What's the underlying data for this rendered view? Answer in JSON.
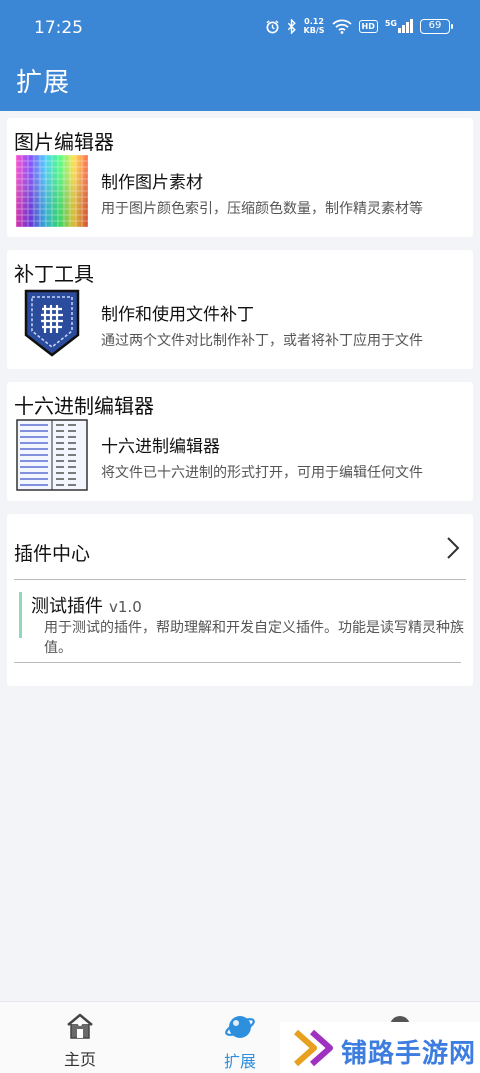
{
  "status_bar": {
    "time": "17:25",
    "net_speed_value": "0.12",
    "net_speed_unit": "KB/S",
    "hd_label": "HD",
    "signal_label": "5G",
    "battery": "69"
  },
  "header": {
    "title": "扩展"
  },
  "cards": [
    {
      "title": "图片编辑器",
      "subtitle": "制作图片素材",
      "description": "用于图片颜色索引，压缩颜色数量，制作精灵素材等",
      "icon": "color-palette-grid-icon"
    },
    {
      "title": "补丁工具",
      "subtitle": "制作和使用文件补丁",
      "description": "通过两个文件对比制作补丁，或者将补丁应用于文件",
      "icon": "patch-badge-icon"
    },
    {
      "title": "十六进制编辑器",
      "subtitle": "十六进制编辑器",
      "description": "将文件已十六进制的形式打开，可用于编辑任何文件",
      "icon": "hex-dump-icon"
    }
  ],
  "plugin_center": {
    "title": "插件中心",
    "items": [
      {
        "name": "测试插件",
        "version": "v1.0",
        "description": "用于测试的插件，帮助理解和开发自定义插件。功能是读写精灵种族值。"
      }
    ]
  },
  "tabbar": {
    "tabs": [
      {
        "label": "主页",
        "icon": "home-icon"
      },
      {
        "label": "扩展",
        "icon": "planet-icon",
        "active": true
      },
      {
        "label": "",
        "icon": "circle-icon"
      }
    ]
  },
  "watermark": {
    "text": "铺路手游网"
  },
  "colors": {
    "primary": "#3c86d6",
    "active_tab": "#2e8fdd",
    "plugin_accent": "#8ed9b8"
  }
}
